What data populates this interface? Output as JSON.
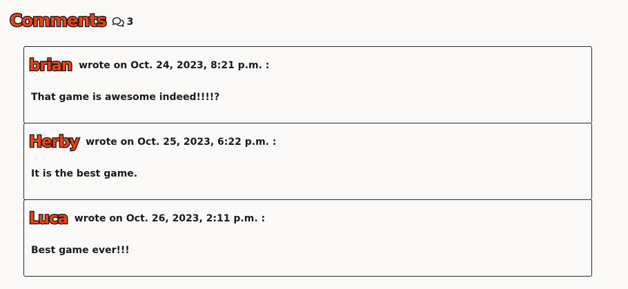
{
  "header": {
    "title": "Comments",
    "count_icon": "comments-icon",
    "count": "3"
  },
  "comments": [
    {
      "author": "brian",
      "meta": "wrote on Oct. 24, 2023, 8:21 p.m. :",
      "body": "That game is awesome indeed!!!!?"
    },
    {
      "author": "Herby",
      "meta": "wrote on Oct. 25, 2023, 6:22 p.m. :",
      "body": "It is the best game."
    },
    {
      "author": "Luca",
      "meta": "wrote on Oct. 26, 2023, 2:11 p.m. :",
      "body": "Best game ever!!!"
    }
  ],
  "colors": {
    "accent": "#e8441a",
    "outline": "#111111",
    "background": "#faf9f7",
    "border": "#2a2a2a"
  }
}
